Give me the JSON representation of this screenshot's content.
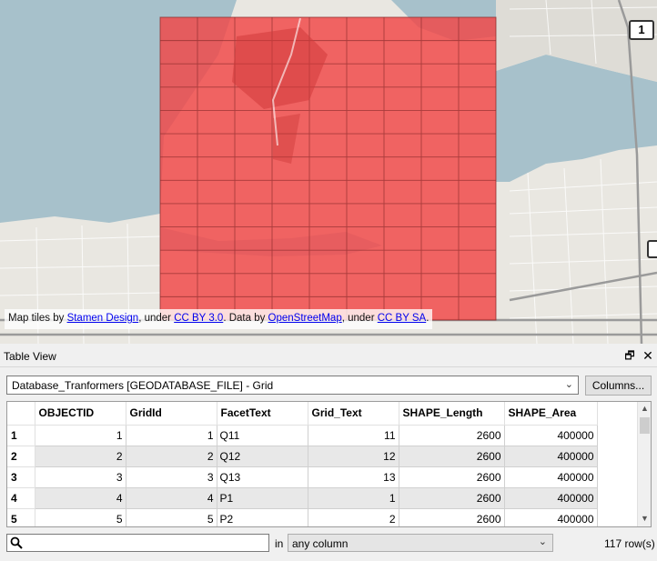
{
  "map": {
    "shield_label": "1",
    "attribution": {
      "t1": "Map tiles by ",
      "link1": "Stamen Design",
      "t2": ", under ",
      "link2": "CC BY 3.0",
      "t3": ". Data by ",
      "link3": "OpenStreetMap",
      "t4": ", under ",
      "link4": "CC BY SA",
      "t5": "."
    },
    "colors": {
      "water": "#a7c1cb",
      "land": "#e9e7e1",
      "overlay": "#f24646",
      "grid_line": "#8a2b2b"
    }
  },
  "panel": {
    "title": "Table View",
    "float_icon": "🗗",
    "close_icon": "✕",
    "layer_select": "Database_Tranformers [GEODATABASE_FILE] - Grid",
    "columns_button": "Columns...",
    "columns": [
      "OBJECTID",
      "GridId",
      "FacetText",
      "Grid_Text",
      "SHAPE_Length",
      "SHAPE_Area"
    ],
    "rows": [
      {
        "rownum": "1",
        "cells": [
          "1",
          "1",
          "Q11",
          "11",
          "2600",
          "400000"
        ]
      },
      {
        "rownum": "2",
        "cells": [
          "2",
          "2",
          "Q12",
          "12",
          "2600",
          "400000"
        ]
      },
      {
        "rownum": "3",
        "cells": [
          "3",
          "3",
          "Q13",
          "13",
          "2600",
          "400000"
        ]
      },
      {
        "rownum": "4",
        "cells": [
          "4",
          "4",
          "P1",
          "1",
          "2600",
          "400000"
        ]
      },
      {
        "rownum": "5",
        "cells": [
          "5",
          "5",
          "P2",
          "2",
          "2600",
          "400000"
        ]
      }
    ],
    "search_value": "",
    "in_label": "in",
    "column_filter": "any column",
    "row_count": "117 row(s)"
  }
}
